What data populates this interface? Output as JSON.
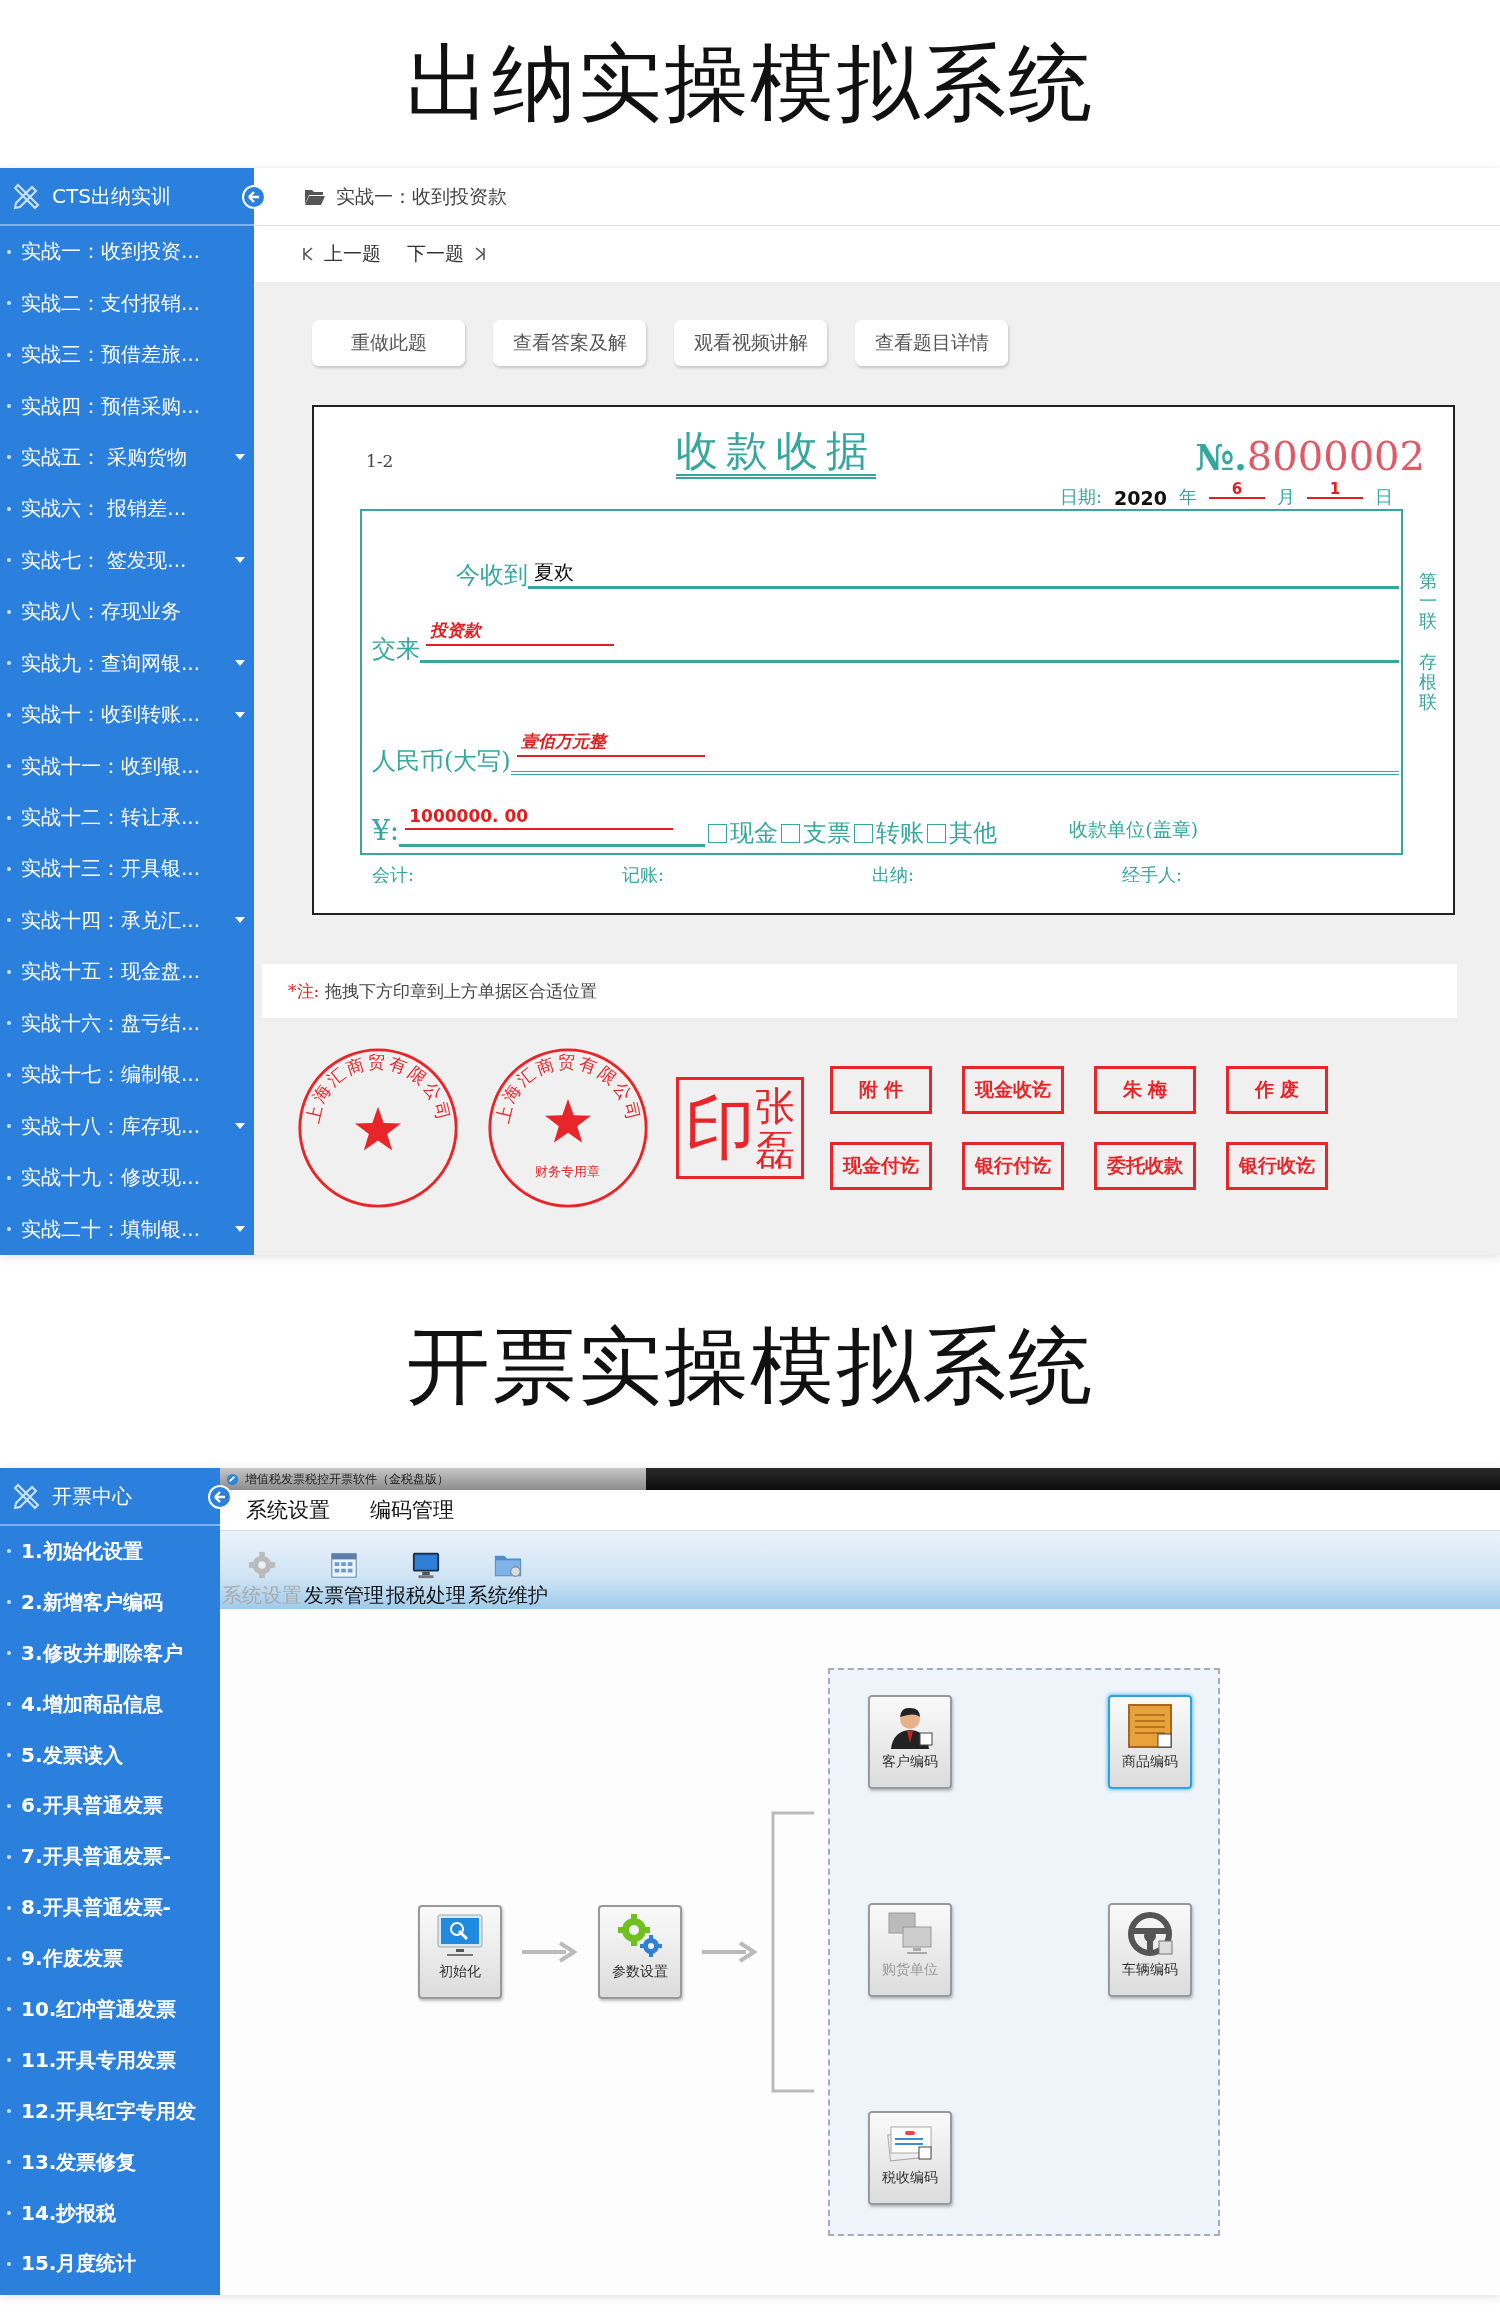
{
  "cashier": {
    "title": "出纳实操模拟系统",
    "sidebar": {
      "title": "CTS出纳实训",
      "items": [
        {
          "label": "实战一：收到投资...",
          "expandable": false
        },
        {
          "label": "实战二：支付报销...",
          "expandable": false
        },
        {
          "label": "实战三：预借差旅...",
          "expandable": false
        },
        {
          "label": "实战四：预借采购...",
          "expandable": false
        },
        {
          "label": "实战五： 采购货物",
          "expandable": true
        },
        {
          "label": "实战六： 报销差...",
          "expandable": false
        },
        {
          "label": "实战七： 签发现...",
          "expandable": true
        },
        {
          "label": "实战八：存现业务",
          "expandable": false
        },
        {
          "label": "实战九：查询网银...",
          "expandable": true
        },
        {
          "label": "实战十：收到转账...",
          "expandable": true
        },
        {
          "label": "实战十一：收到银...",
          "expandable": false
        },
        {
          "label": "实战十二：转让承...",
          "expandable": false
        },
        {
          "label": "实战十三：开具银...",
          "expandable": false
        },
        {
          "label": "实战十四：承兑汇...",
          "expandable": true
        },
        {
          "label": "实战十五：现金盘...",
          "expandable": false
        },
        {
          "label": "实战十六：盘亏结...",
          "expandable": false
        },
        {
          "label": "实战十七：编制银...",
          "expandable": false
        },
        {
          "label": "实战十八：库存现...",
          "expandable": true
        },
        {
          "label": "实战十九：修改现...",
          "expandable": false
        },
        {
          "label": "实战二十：填制银...",
          "expandable": true
        }
      ]
    },
    "breadcrumb": "实战一：收到投资款",
    "pager": {
      "prev": "上一题",
      "next": "下一题"
    },
    "actions": [
      "重做此题",
      "查看答案及解",
      "观看视频讲解",
      "查看题目详情"
    ],
    "receipt": {
      "code": "1-2",
      "title": "收款收据",
      "number_label": "№.",
      "number": "8000002",
      "date": {
        "label": "日期:",
        "parts": [
          {
            "value": "2020",
            "unit": "年",
            "kind": "typed"
          },
          {
            "value": "6",
            "unit": "月",
            "kind": "handwritten"
          },
          {
            "value": "1",
            "unit": "日",
            "kind": "handwritten"
          }
        ]
      },
      "fields": [
        {
          "label": "今收到",
          "value": "夏欢",
          "kind": "typed"
        },
        {
          "label": "交来",
          "value": "投资款",
          "kind": "handwritten"
        },
        {
          "label": "人民币(大写)",
          "value": "壹佰万元整",
          "kind": "handwritten"
        }
      ],
      "amount": {
        "label": "¥:",
        "value": "1000000. 00"
      },
      "methods": [
        {
          "label": "现金",
          "checked": false
        },
        {
          "label": "支票",
          "checked": false
        },
        {
          "label": "转账",
          "checked": false
        },
        {
          "label": "其他",
          "checked": false
        }
      ],
      "payee": "收款单位(盖章)",
      "copy_labels": [
        "第一联",
        "存根联"
      ],
      "signatures": [
        "会计:",
        "记账:",
        "出纳:",
        "经手人:"
      ]
    },
    "note": {
      "mark": "*注:",
      "text": "拖拽下方印章到上方单据区合适位置"
    },
    "stamps": {
      "seals": [
        {
          "text": "上海汇商贸有限公司"
        },
        {
          "text": "上海汇商贸有限公司",
          "subtext": "财务专用章"
        }
      ],
      "name_seal": {
        "name": "张磊",
        "suffix": "印"
      },
      "labels": [
        "附 件",
        "现金收讫",
        "朱 梅",
        "作 废",
        "现金付讫",
        "银行付讫",
        "委托收款",
        "银行收讫"
      ]
    }
  },
  "invoicing": {
    "title": "开票实操模拟系统",
    "sidebar": {
      "title": "开票中心",
      "items": [
        "1.初始化设置",
        "2.新增客户编码",
        "3.修改并删除客户",
        "4.增加商品信息",
        "5.发票读入",
        "6.开具普通发票",
        "7.开具普通发票-",
        "8.开具普通发票-",
        "9.作废发票",
        "10.红冲普通发票",
        "11.开具专用发票",
        "12.开具红字专用发",
        "13.发票修复",
        "14.抄报税",
        "15.月度统计"
      ]
    },
    "window_title": "增值税发票税控开票软件（金税盘版）",
    "menu": [
      "系统设置",
      "编码管理"
    ],
    "toolbar": [
      {
        "label": "系统设置",
        "disabled": true
      },
      {
        "label": "发票管理",
        "disabled": false
      },
      {
        "label": "报税处理",
        "disabled": false
      },
      {
        "label": "系统维护",
        "disabled": false
      }
    ],
    "flow": [
      {
        "label": "初始化"
      },
      {
        "label": "参数设置"
      }
    ],
    "codes": [
      {
        "label": "客户编码",
        "selected": false,
        "disabled": false
      },
      {
        "label": "商品编码",
        "selected": true,
        "disabled": false
      },
      {
        "label": "购货单位",
        "selected": false,
        "disabled": true
      },
      {
        "label": "车辆编码",
        "selected": false,
        "disabled": false
      },
      {
        "label": "税收编码",
        "selected": false,
        "disabled": false
      }
    ]
  }
}
